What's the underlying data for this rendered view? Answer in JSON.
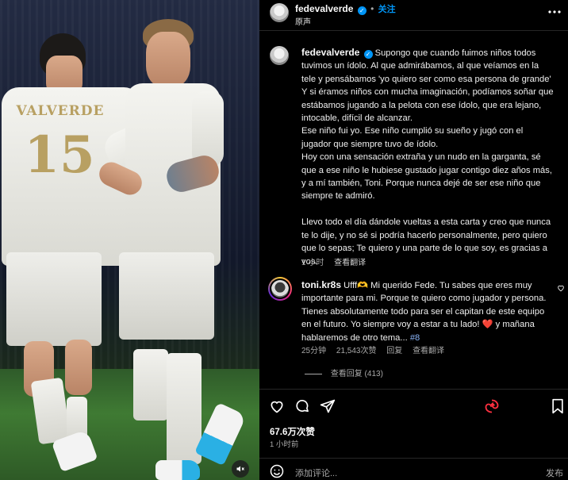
{
  "post_header": {
    "username": "fedevalverde",
    "separator": "•",
    "follow_label": "关注",
    "subtitle": "原声",
    "more_icon": "more-horizontal-icon"
  },
  "photo": {
    "jersey_name": "VALVERDE",
    "jersey_number": "15",
    "mute_icon": "speaker-muted-icon"
  },
  "caption": {
    "username": "fedevalverde",
    "lines": [
      "Supongo que cuando fuimos niños todos tuvimos un ídolo. Al que admirábamos, al que veíamos en la tele y pensábamos 'yo quiero ser como esa persona de grande'",
      "Y si éramos niños con mucha imaginación, podíamos soñar que estábamos jugando a la pelota con ese ídolo, que era lejano, intocable, difícil de alcanzar.",
      "Ese niño fui yo. Ese niño cumplió su sueño y jugó con el jugador que siempre tuvo de ídolo.",
      "Hoy con una sensación extraña y un nudo en la garganta, sé que a ese niño le hubiese gustado jugar contigo diez años más, y a mí también, Toni. Porque nunca dejé de ser ese niño que siempre te admiró.",
      "",
      "Llevo todo el día dándole vueltas a esta carta y creo que nunca te lo dije, y no sé si podría hacerlo personalmente, pero quiero que lo sepas; Te quiero y una parte de lo que soy, es gracias a vos."
    ],
    "time": "1 小时",
    "translate_label": "查看翻译"
  },
  "comment": {
    "username": "toni.kr8s",
    "text_before": "Ufff🫶 Mi querido Fede. Tu sabes que eres muy importante para mi. Porque te quiero como jugador y persona. Tienes absolutamente todo para ser el capitan de este equipo en el futuro. Yo siempre voy a estar a tu lado! ",
    "heart_emoji": "❤️",
    "text_after": " y mañana hablaremos de otro tema...",
    "mention": "#8",
    "time": "25分钟",
    "likes": "21,543次赞",
    "reply_label": "回复",
    "translate_label": "查看翻译",
    "view_replies_label": "查看回复 (413)",
    "like_icon": "heart-outline-icon"
  },
  "actions": {
    "like_icon": "heart-outline-icon",
    "comment_icon": "comment-bubble-icon",
    "share_icon": "paper-plane-icon",
    "repost_icon": "repost-icon",
    "save_icon": "bookmark-icon",
    "likes_count": "67.6万次赞",
    "time": "1 小时前"
  },
  "comment_box": {
    "emoji_icon": "smiley-icon",
    "placeholder": "添加评论...",
    "post_label": "发布"
  },
  "colors": {
    "background": "#000000",
    "verified": "#0095f6",
    "repost_accent": "#ff3040",
    "mention": "#8ab4f8"
  }
}
